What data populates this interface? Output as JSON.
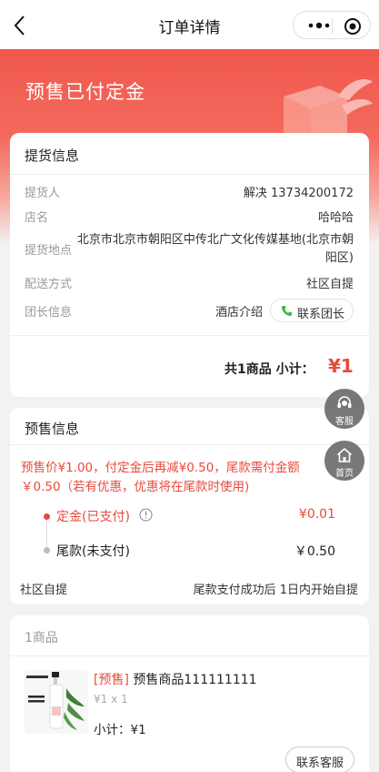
{
  "nav": {
    "title": "订单详情"
  },
  "hero": {
    "status": "预售已付定金"
  },
  "pickup": {
    "title": "提货信息",
    "rows": [
      {
        "label": "提货人",
        "value": "解决 13734200172"
      },
      {
        "label": "店名",
        "value": "哈哈哈"
      },
      {
        "label": "提货地点",
        "value": "北京市北京市朝阳区中传北广文化传媒基地(北京市朝阳区)"
      },
      {
        "label": "配送方式",
        "value": "社区自提"
      },
      {
        "label": "团长信息",
        "value": "酒店介绍"
      }
    ],
    "contact_label": "联系团长",
    "summary_label": "共1商品  小计：",
    "summary_value": "¥1"
  },
  "presale": {
    "title": "预售信息",
    "note": "预售价¥1.00，付定金后再减¥0.50，尾款需付金额￥0.50（若有优惠，优惠将在尾款时使用)",
    "deposit_label": "定金(已支付)",
    "deposit_value": "¥0.01",
    "balance_label": "尾款(未支付)",
    "balance_value": "￥0.50",
    "footer_left": "社区自提",
    "footer_right": "尾款支付成功后 1日内开始自提"
  },
  "goods": {
    "title": "1商品",
    "tag": "[预售]",
    "name": " 预售商品111111111",
    "spec": "¥1 x 1",
    "subtotal": "小计：¥1",
    "service_label": "联系客服"
  },
  "fab": {
    "service_label": "客服",
    "home_label": "首页"
  },
  "colors": {
    "accent": "#e84b3c",
    "hero_top": "#f0574d"
  },
  "icons": [
    "back-arrow-icon",
    "more-dots-icon",
    "target-circle-icon",
    "gift-box-icon",
    "phone-icon",
    "info-circle-icon",
    "headset-icon",
    "home-icon"
  ]
}
